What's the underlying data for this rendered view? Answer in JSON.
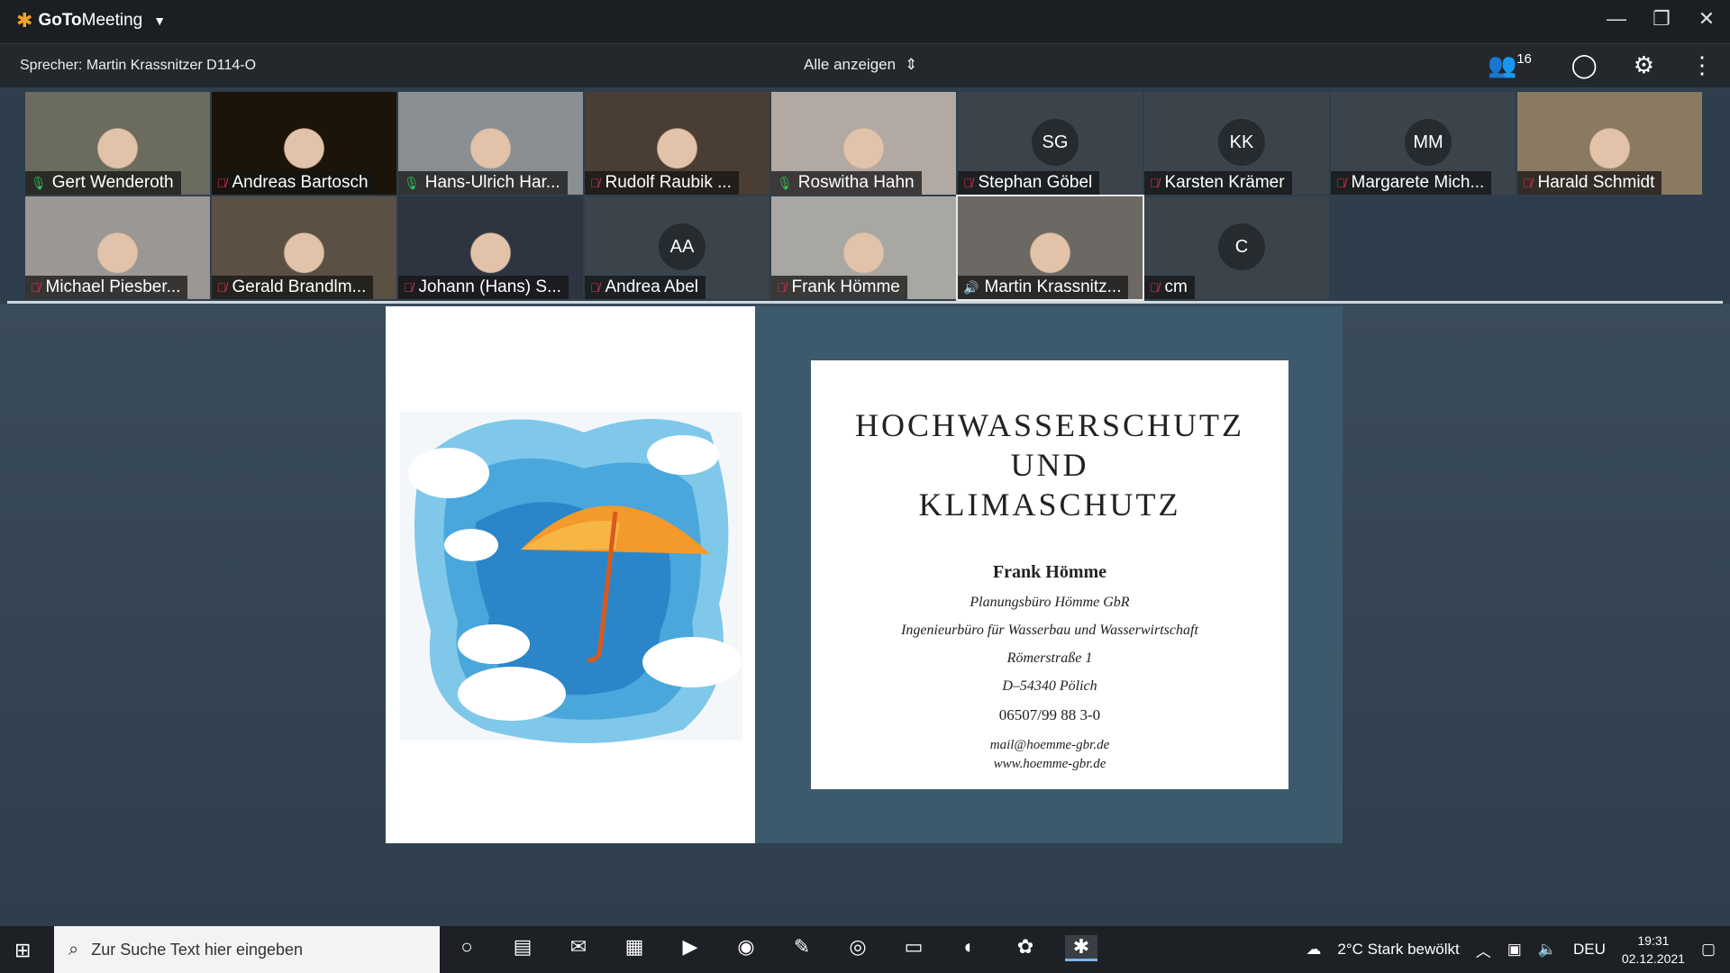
{
  "app": {
    "name_bold": "GoTo",
    "name_rest": "Meeting"
  },
  "toolbar": {
    "speaker": "Sprecher: Martin Krassnitzer D114-O",
    "view_label": "Alle anzeigen",
    "participants_count": "16"
  },
  "participants": [
    {
      "name": "Gert Wenderoth",
      "mic": "on",
      "video": true,
      "color": "#6b6b5e"
    },
    {
      "name": "Andreas Bartosch",
      "mic": "muted",
      "video": true,
      "color": "#1c1408"
    },
    {
      "name": "Hans-Ulrich Har...",
      "mic": "on",
      "video": true,
      "color": "#8a8f93"
    },
    {
      "name": "Rudolf Raubik ...",
      "mic": "muted",
      "video": true,
      "color": "#4a3d33"
    },
    {
      "name": "Roswitha Hahn",
      "mic": "on",
      "video": true,
      "color": "#b3a9a3"
    },
    {
      "name": "Stephan Göbel",
      "mic": "muted",
      "video": false,
      "initials": "SG"
    },
    {
      "name": "Karsten Krämer",
      "mic": "muted",
      "video": false,
      "initials": "KK"
    },
    {
      "name": "Margarete Mich...",
      "mic": "muted",
      "video": false,
      "initials": "MM"
    },
    {
      "name": "Harald Schmidt",
      "mic": "muted",
      "video": true,
      "color": "#8a7a62"
    },
    {
      "name": "Michael Piesber...",
      "mic": "muted",
      "video": true,
      "color": "#9a9794"
    },
    {
      "name": "Gerald Brandlm...",
      "mic": "muted",
      "video": true,
      "color": "#5a5044"
    },
    {
      "name": "Johann (Hans) S...",
      "mic": "muted",
      "video": true,
      "color": "#2e3540"
    },
    {
      "name": "Andrea Abel",
      "mic": "muted",
      "video": false,
      "initials": "AA"
    },
    {
      "name": "Frank Hömme",
      "mic": "muted",
      "video": true,
      "color": "#a9a7a1"
    },
    {
      "name": "Martin Krassnitz...",
      "mic": "speaking",
      "video": true,
      "color": "#6c6863"
    },
    {
      "name": "cm",
      "mic": "muted",
      "video": false,
      "initials": "C"
    }
  ],
  "slide": {
    "title_lines": [
      "HOCHWASSERSCHUTZ",
      "UND",
      "KLIMASCHUTZ"
    ],
    "person": "Frank Hömme",
    "company": "Planungsbüro Hömme GbR",
    "subtitle": "Ingenieurbüro für Wasserbau und Wasserwirtschaft",
    "street": "Römerstraße 1",
    "city": "D–54340 Pölich",
    "phone": "06507/99 88 3-0",
    "email": "mail@hoemme-gbr.de",
    "web": "www.hoemme-gbr.de"
  },
  "taskbar": {
    "search_placeholder": "Zur Suche Text hier eingeben",
    "weather": "2°C  Stark bewölkt",
    "lang": "DEU",
    "time": "19:31",
    "date": "02.12.2021"
  }
}
